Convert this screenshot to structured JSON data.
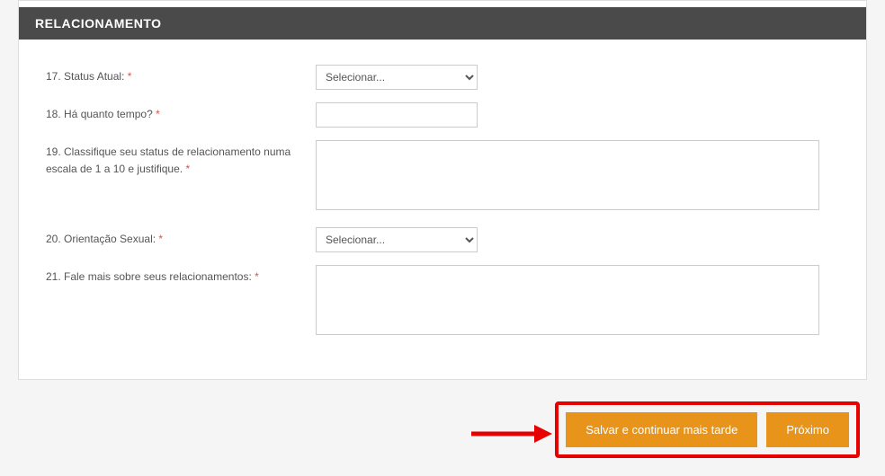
{
  "section": {
    "title": "RELACIONAMENTO"
  },
  "fields": {
    "q17": {
      "label": "17. Status Atual:",
      "placeholder": "Selecionar..."
    },
    "q18": {
      "label": "18. Há quanto tempo?"
    },
    "q19": {
      "label": "19. Classifique seu status de relacionamento numa escala de 1 a 10 e justifique."
    },
    "q20": {
      "label": "20. Orientação Sexual:",
      "placeholder": "Selecionar..."
    },
    "q21": {
      "label": "21. Fale mais sobre seus relacionamentos:"
    }
  },
  "buttons": {
    "save": "Salvar e continuar mais tarde",
    "next": "Próximo"
  },
  "required_marker": "*"
}
